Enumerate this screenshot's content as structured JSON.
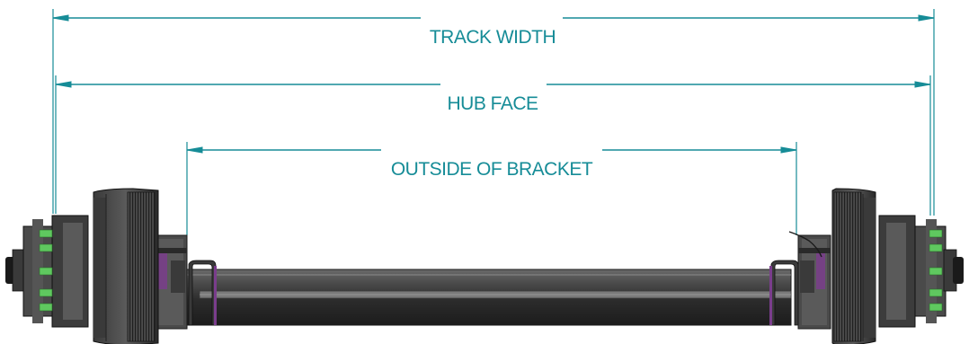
{
  "dimensions": {
    "track_width": "TRACK WIDTH",
    "hub_face": "HUB FACE",
    "outside_of_bracket": "OUTSIDE OF BRACKET"
  },
  "colors": {
    "dimension_line": "#168c97",
    "part_dark": "#2f2f2f",
    "part_mid": "#595959",
    "part_light": "#8a8a8a",
    "bolt": "#5fc85f",
    "accent": "#7a3d8c"
  }
}
